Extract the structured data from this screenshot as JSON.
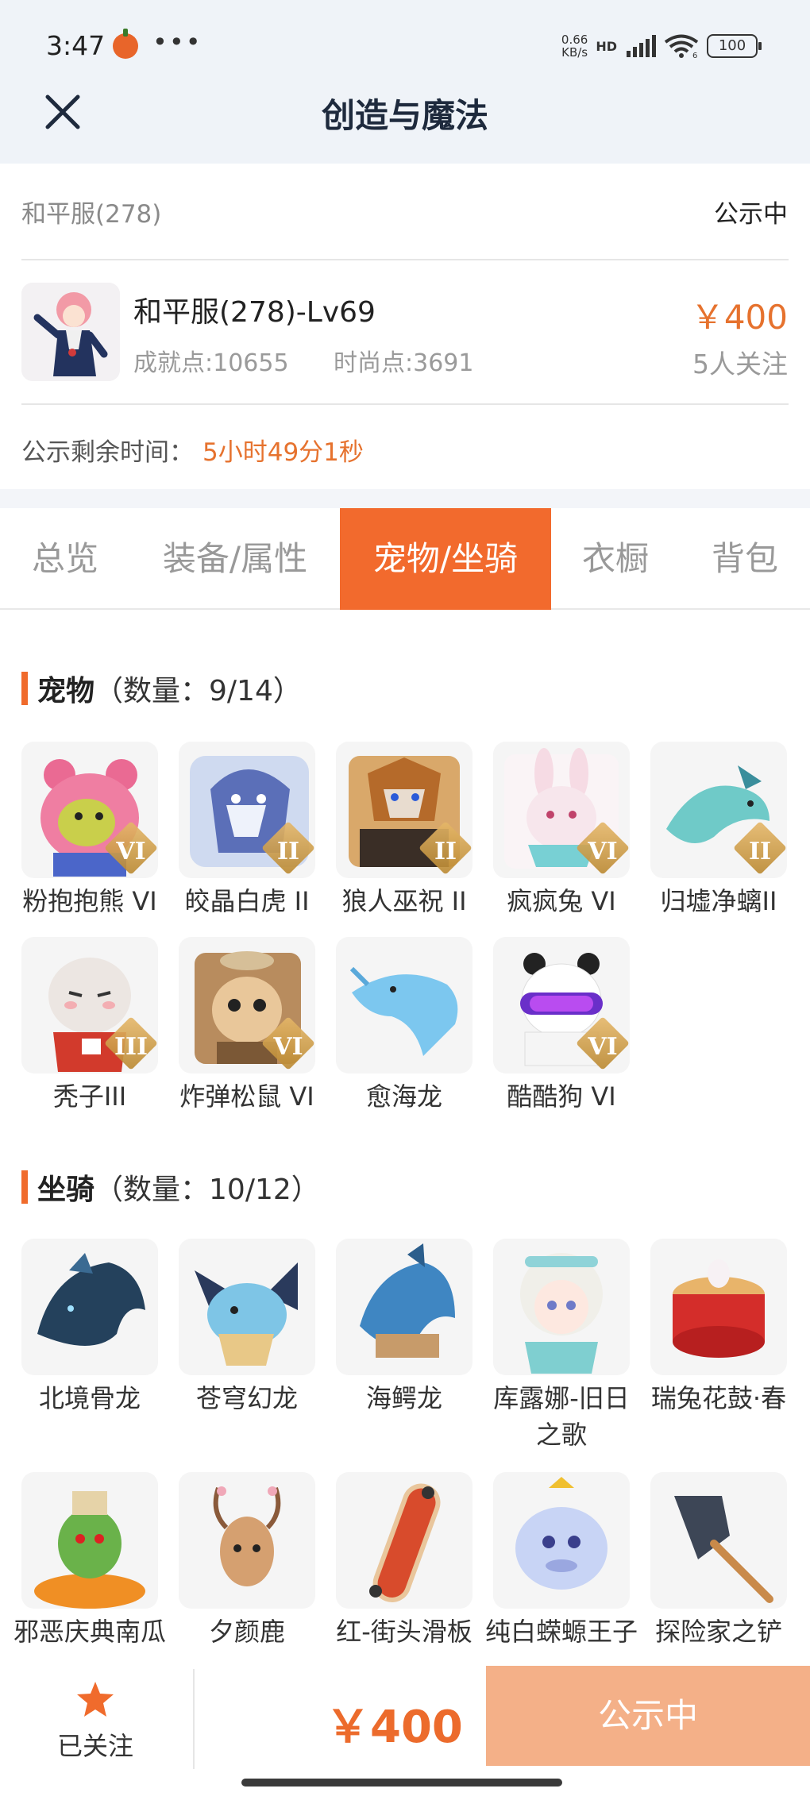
{
  "status_bar": {
    "time": "3:47",
    "dots": "•••",
    "net_speed_top": "0.66",
    "net_speed_unit": "KB/s",
    "hd": "HD",
    "wifi_sub": "6",
    "battery": "100"
  },
  "header": {
    "title": "创造与魔法"
  },
  "listing": {
    "server": "和平服(278)",
    "status": "公示中",
    "role_name": "和平服(278)-Lv69",
    "achievement": "成就点:10655",
    "fashion": "时尚点:3691",
    "price": "￥400",
    "followers": "5人关注",
    "remain_label": "公示剩余时间：",
    "remain_time": "5小时49分1秒"
  },
  "tabs": [
    {
      "label": "总览"
    },
    {
      "label": "装备/属性"
    },
    {
      "label": "宠物/坐骑"
    },
    {
      "label": "衣橱"
    },
    {
      "label": "背包"
    }
  ],
  "pets": {
    "name": "宠物",
    "count": "（数量：9/14）",
    "items": [
      {
        "label": "粉抱抱熊 VI",
        "rank": "VI"
      },
      {
        "label": "皎晶白虎 II",
        "rank": "II"
      },
      {
        "label": "狼人巫祝 II",
        "rank": "II"
      },
      {
        "label": "疯疯兔 VI",
        "rank": "VI"
      },
      {
        "label": "归墟净螭II",
        "rank": "II"
      },
      {
        "label": "秃子III",
        "rank": "III"
      },
      {
        "label": "炸弹松鼠 VI",
        "rank": "VI"
      },
      {
        "label": "愈海龙",
        "rank": ""
      },
      {
        "label": "酷酷狗 VI",
        "rank": "VI"
      }
    ]
  },
  "mounts": {
    "name": "坐骑",
    "count": "（数量：10/12）",
    "items": [
      {
        "label": "北境骨龙"
      },
      {
        "label": "苍穹幻龙"
      },
      {
        "label": "海鳄龙"
      },
      {
        "label": "库露娜-旧日之歌"
      },
      {
        "label": "瑞兔花鼓·春"
      },
      {
        "label": "邪恶庆典南瓜"
      },
      {
        "label": "夕颜鹿"
      },
      {
        "label": "红-街头滑板"
      },
      {
        "label": "纯白蝾螈王子"
      },
      {
        "label": "探险家之铲"
      }
    ]
  },
  "bottom": {
    "follow_label": "已关注",
    "price": "￥400",
    "status": "公示中"
  },
  "colors": {
    "accent": "#f26a2d",
    "price": "#e6722e",
    "status_button": "#f4b088"
  }
}
